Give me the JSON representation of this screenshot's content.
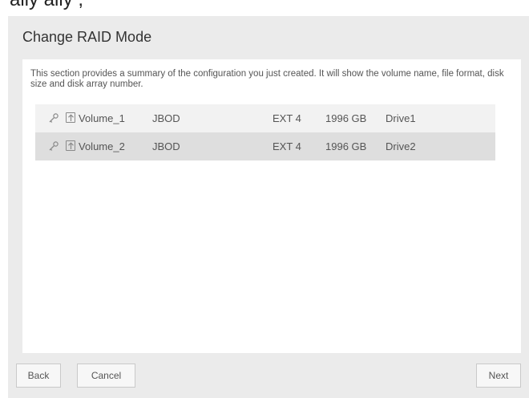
{
  "clipped_heading": "ally ally             ,     ",
  "dialog": {
    "title": "Change RAID Mode",
    "description": "This section provides a summary of the configuration you just created. It will show the volume name, file format, disk size and disk array number."
  },
  "volumes": [
    {
      "name": "Volume_1",
      "raid": "JBOD",
      "format": "EXT 4",
      "size": "1996 GB",
      "drive": "Drive1"
    },
    {
      "name": "Volume_2",
      "raid": "JBOD",
      "format": "EXT 4",
      "size": "1996 GB",
      "drive": "Drive2"
    }
  ],
  "buttons": {
    "back": "Back",
    "cancel": "Cancel",
    "next": "Next"
  },
  "icons": {
    "key": "key-icon",
    "share": "share-upload-icon"
  },
  "colors": {
    "dialog_bg": "#ebebeb",
    "row_alt": "#dedede",
    "row": "#f2f2f2"
  }
}
